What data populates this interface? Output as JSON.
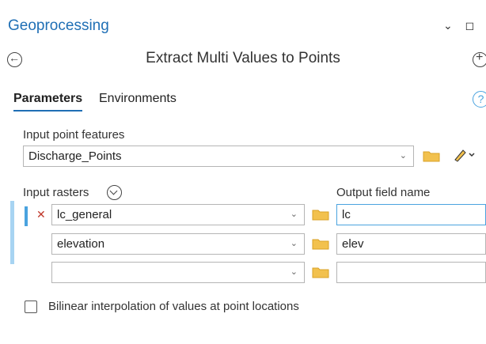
{
  "pane": {
    "title": "Geoprocessing",
    "controls": "⌄ ◻ ✕"
  },
  "tool": {
    "title": "Extract Multi Values to Points"
  },
  "tabs": [
    {
      "label": "Parameters",
      "active": true
    },
    {
      "label": "Environments",
      "active": false
    }
  ],
  "help": "?",
  "input_point_features": {
    "label": "Input point features",
    "value": "Discharge_Points"
  },
  "rasters": {
    "label": "Input rasters",
    "output_label": "Output field name",
    "rows": [
      {
        "raster": "lc_general",
        "field": "lc"
      },
      {
        "raster": "elevation",
        "field": "elev"
      },
      {
        "raster": "",
        "field": ""
      }
    ]
  },
  "bilinear": {
    "label": "Bilinear interpolation of values at point locations",
    "checked": false
  },
  "colors": {
    "accent": "#1f6fb5",
    "folder": "#f2c14e",
    "remove": "#c0392b",
    "active_row": "#4aa3df"
  }
}
